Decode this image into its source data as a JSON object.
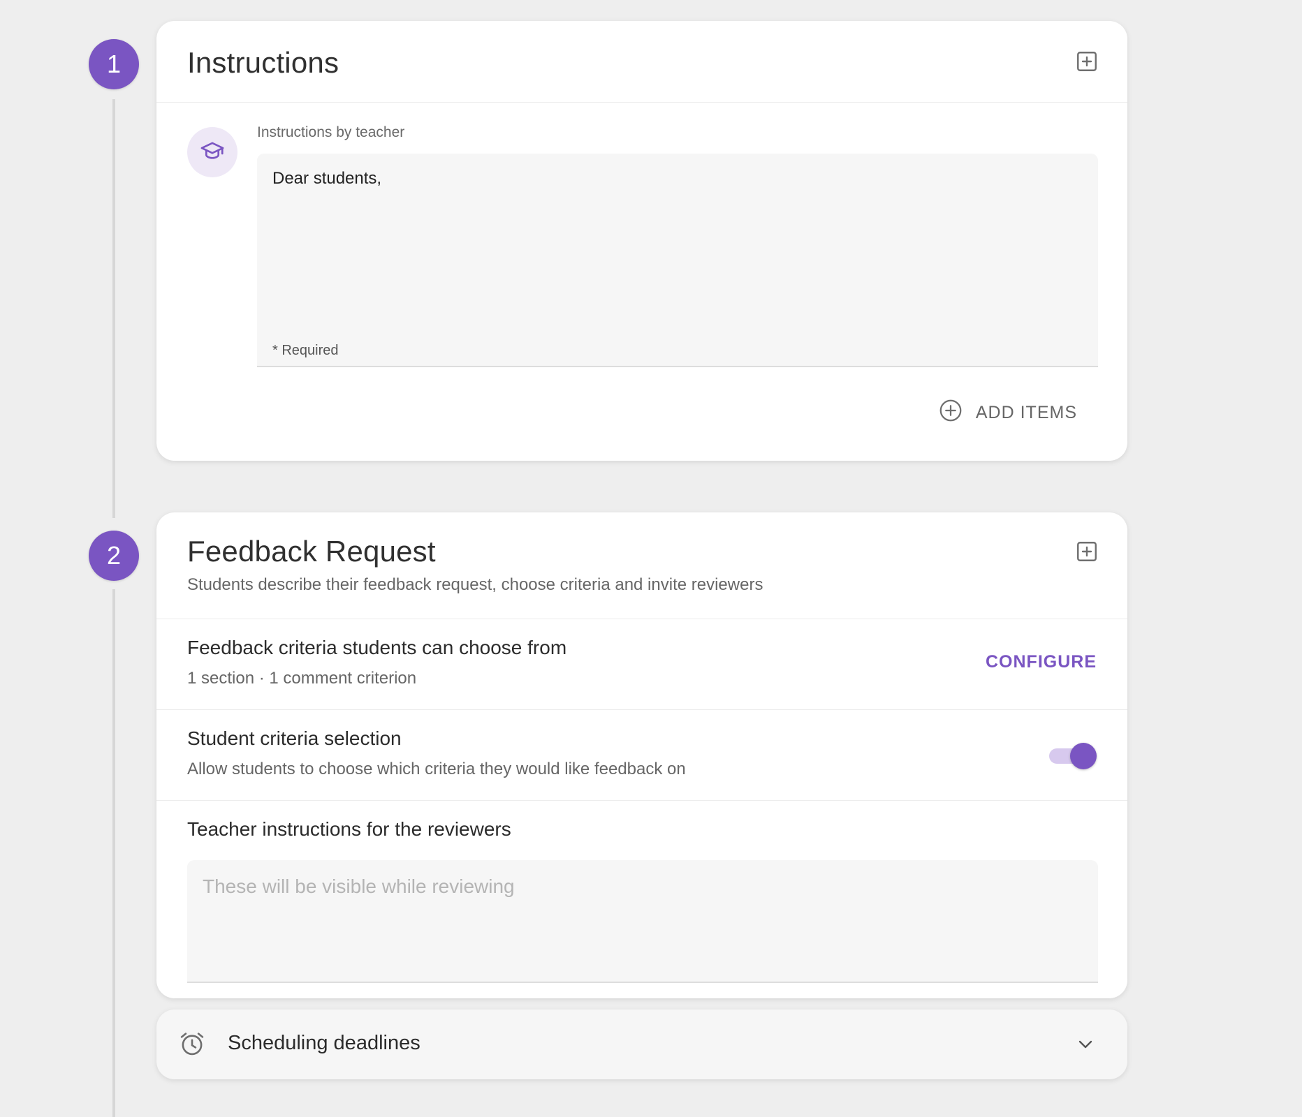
{
  "steps": [
    {
      "number": "1",
      "title": "Instructions"
    },
    {
      "number": "2",
      "title": "Feedback Request",
      "subtitle": "Students describe their feedback request, choose criteria and invite reviewers"
    }
  ],
  "instructions": {
    "field_label": "Instructions by teacher",
    "value": "Dear students,",
    "required_hint": "* Required",
    "add_items_label": "ADD ITEMS"
  },
  "feedback_request": {
    "criteria": {
      "title": "Feedback criteria students can choose from",
      "summary": "1 section · 1 comment criterion",
      "configure_label": "CONFIGURE"
    },
    "student_selection": {
      "title": "Student criteria selection",
      "description": "Allow students to choose which criteria they would like feedback on",
      "enabled": true
    },
    "reviewer_instructions": {
      "title": "Teacher instructions for the reviewers",
      "placeholder": "These will be visible while reviewing"
    }
  },
  "scheduling": {
    "label": "Scheduling deadlines"
  },
  "icons": {
    "note_add": "note-add-icon",
    "teacher": "graduation-cap-icon",
    "add": "add-circle-icon",
    "alarm": "alarm-icon",
    "expand": "chevron-down-icon"
  },
  "colors": {
    "accent": "#7a55c2",
    "background": "#eeeeee"
  }
}
